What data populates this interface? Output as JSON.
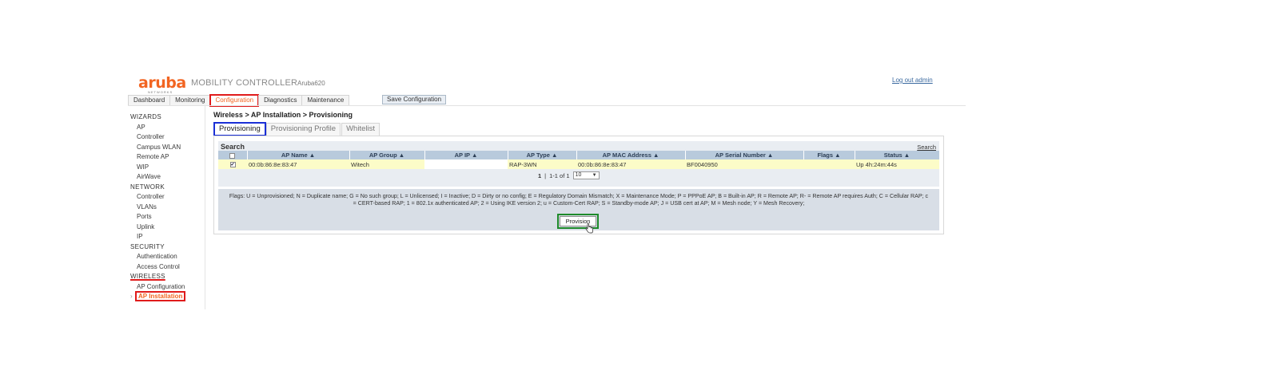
{
  "header": {
    "logo_text": "aruba",
    "logo_sub": "NETWORKS",
    "product": "MOBILITY CONTROLLER",
    "hostname": "Aruba620",
    "logout": "Log out admin"
  },
  "topnav": {
    "tabs": [
      {
        "label": "Dashboard"
      },
      {
        "label": "Monitoring"
      },
      {
        "label": "Configuration",
        "active": true
      },
      {
        "label": "Diagnostics"
      },
      {
        "label": "Maintenance"
      }
    ],
    "save_label": "Save Configuration"
  },
  "sidebar": {
    "wizards": {
      "title": "WIZARDS",
      "items": [
        "AP",
        "Controller",
        "Campus WLAN",
        "Remote AP",
        "WIP",
        "AirWave"
      ]
    },
    "network": {
      "title": "NETWORK",
      "items": [
        "Controller",
        "VLANs",
        "Ports",
        "Uplink",
        "IP"
      ]
    },
    "security": {
      "title": "SECURITY",
      "items": [
        "Authentication",
        "Access Control"
      ]
    },
    "wireless": {
      "title": "WIRELESS",
      "items": [
        "AP Configuration",
        "AP Installation"
      ],
      "active_item": "AP Installation"
    }
  },
  "main": {
    "breadcrumb": "Wireless > AP Installation > Provisioning",
    "tabs": [
      "Provisioning",
      "Provisioning Profile",
      "Whitelist"
    ],
    "search": {
      "title": "Search",
      "link": "Search"
    },
    "table": {
      "columns": [
        "AP Name",
        "AP Group ▲",
        "AP IP ▲",
        "AP Type ▲",
        "AP MAC Address ▲",
        "AP Serial Number ▲",
        "Flags ▲",
        "Status ▲"
      ],
      "first_column_sort": "AP Name ▲",
      "rows": [
        {
          "checked": true,
          "ap_name": "00:0b:86:8e:83:47",
          "ap_group": "Witech",
          "ap_ip": "",
          "ap_type": "RAP-3WN",
          "ap_mac": "00:0b:86:8e:83:47",
          "ap_serial": "BF0040950",
          "flags": "",
          "status": "Up 4h:24m:44s"
        }
      ]
    },
    "pager": {
      "page": "1",
      "range": "1-1 of 1",
      "page_size": "10"
    },
    "flags_legend": "Flags: U = Unprovisioned; N = Duplicate name; G = No such group; L = Unlicensed; I = Inactive; D = Dirty or no config; E = Regulatory Domain Mismatch; X = Maintenance Mode; P = PPPoE AP; B = Built-in AP; R = Remote AP; R- = Remote AP requires Auth; C = Cellular RAP; c = CERT-based RAP; 1 = 802.1x authenticated AP; 2 = Using IKE version 2; u = Custom-Cert RAP; S = Standby-mode AP; J = USB cert at AP; M = Mesh node; Y = Mesh Recovery;",
    "provision_label": "Provision"
  },
  "colors": {
    "brand": "#f26522",
    "table_header": "#b8cadc",
    "row_highlight": "#fcfcc8",
    "annotation_red": "#e01b1b",
    "annotation_blue": "#1a2fd6",
    "annotation_green": "#1e8a2a"
  }
}
